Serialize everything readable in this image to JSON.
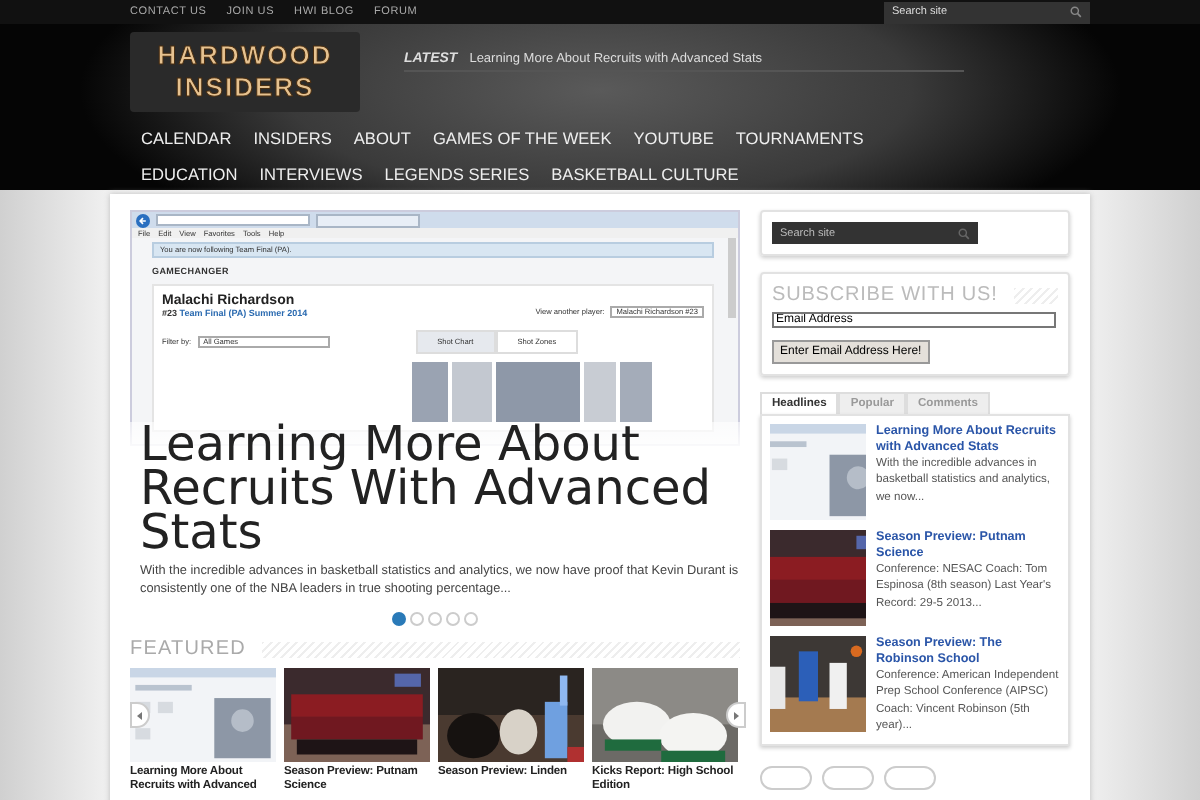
{
  "top_links": [
    "CONTACT US",
    "JOIN US",
    "HWI BLOG",
    "FORUM"
  ],
  "top_search": {
    "placeholder": "Search site"
  },
  "logo": {
    "line1": "HARDWOOD",
    "line2": "INSIDERS"
  },
  "latest": {
    "label": "LATEST",
    "headline": "Learning More About Recruits with Advanced Stats"
  },
  "nav": [
    "CALENDAR",
    "INSIDERS",
    "ABOUT",
    "GAMES OF THE WEEK",
    "YOUTUBE",
    "TOURNAMENTS",
    "EDUCATION",
    "INTERVIEWS",
    "LEGENDS SERIES",
    "BASKETBALL CULTURE"
  ],
  "slider": {
    "screenshot": {
      "menu": [
        "File",
        "Edit",
        "View",
        "Favorites",
        "Tools",
        "Help"
      ],
      "notice": "You are now following Team Final (PA).",
      "brand": "GAMECHANGER",
      "player": "Malachi Richardson",
      "number": "#23",
      "team": "Team Final (PA) Summer 2014",
      "filter_label": "Filter by:",
      "filter_value": "All Games",
      "other_label": "View another player:",
      "other_value": "Malachi Richardson #23",
      "buttons": [
        {
          "label": "Shot Chart",
          "selected": true
        },
        {
          "label": "Shot Zones",
          "selected": false
        }
      ]
    },
    "title": "Learning More About Recruits With Advanced Stats",
    "excerpt": "With the incredible advances in basketball statistics and analytics, we now have proof that Kevin Durant is consistently one of the NBA leaders in true shooting percentage...",
    "dots": [
      {
        "selected": true
      },
      {
        "selected": false
      },
      {
        "selected": false
      },
      {
        "selected": false
      },
      {
        "selected": false
      }
    ]
  },
  "featured": {
    "title": "FEATURED",
    "items": [
      {
        "caption": "Learning More About Recruits with Advanced"
      },
      {
        "caption": "Season Preview: Putnam Science"
      },
      {
        "caption": "Season Preview: Linden"
      },
      {
        "caption": "Kicks Report: High School Edition"
      }
    ]
  },
  "sidebar": {
    "search": {
      "placeholder": "Search site"
    },
    "subscribe": {
      "title": "SUBSCRIBE WITH US!",
      "email": "Email Address",
      "button": "Enter Email Address Here!"
    },
    "tabs": [
      {
        "label": "Headlines",
        "selected": true
      },
      {
        "label": "Popular",
        "selected": false
      },
      {
        "label": "Comments",
        "selected": false
      }
    ],
    "headlines": [
      {
        "title": "Learning More About Recruits with Advanced Stats",
        "excerpt": "With the incredible advances in basketball statistics and analytics, we now..."
      },
      {
        "title": "Season Preview: Putnam Science",
        "excerpt": "Conference: NESAC Coach: Tom Espinosa (8th season) Last Year's Record: 29-5 2013..."
      },
      {
        "title": "Season Preview: The Robinson School",
        "excerpt": "Conference: American Independent Prep School Conference (AIPSC) Coach: Vincent Robinson (5th year)..."
      }
    ]
  }
}
